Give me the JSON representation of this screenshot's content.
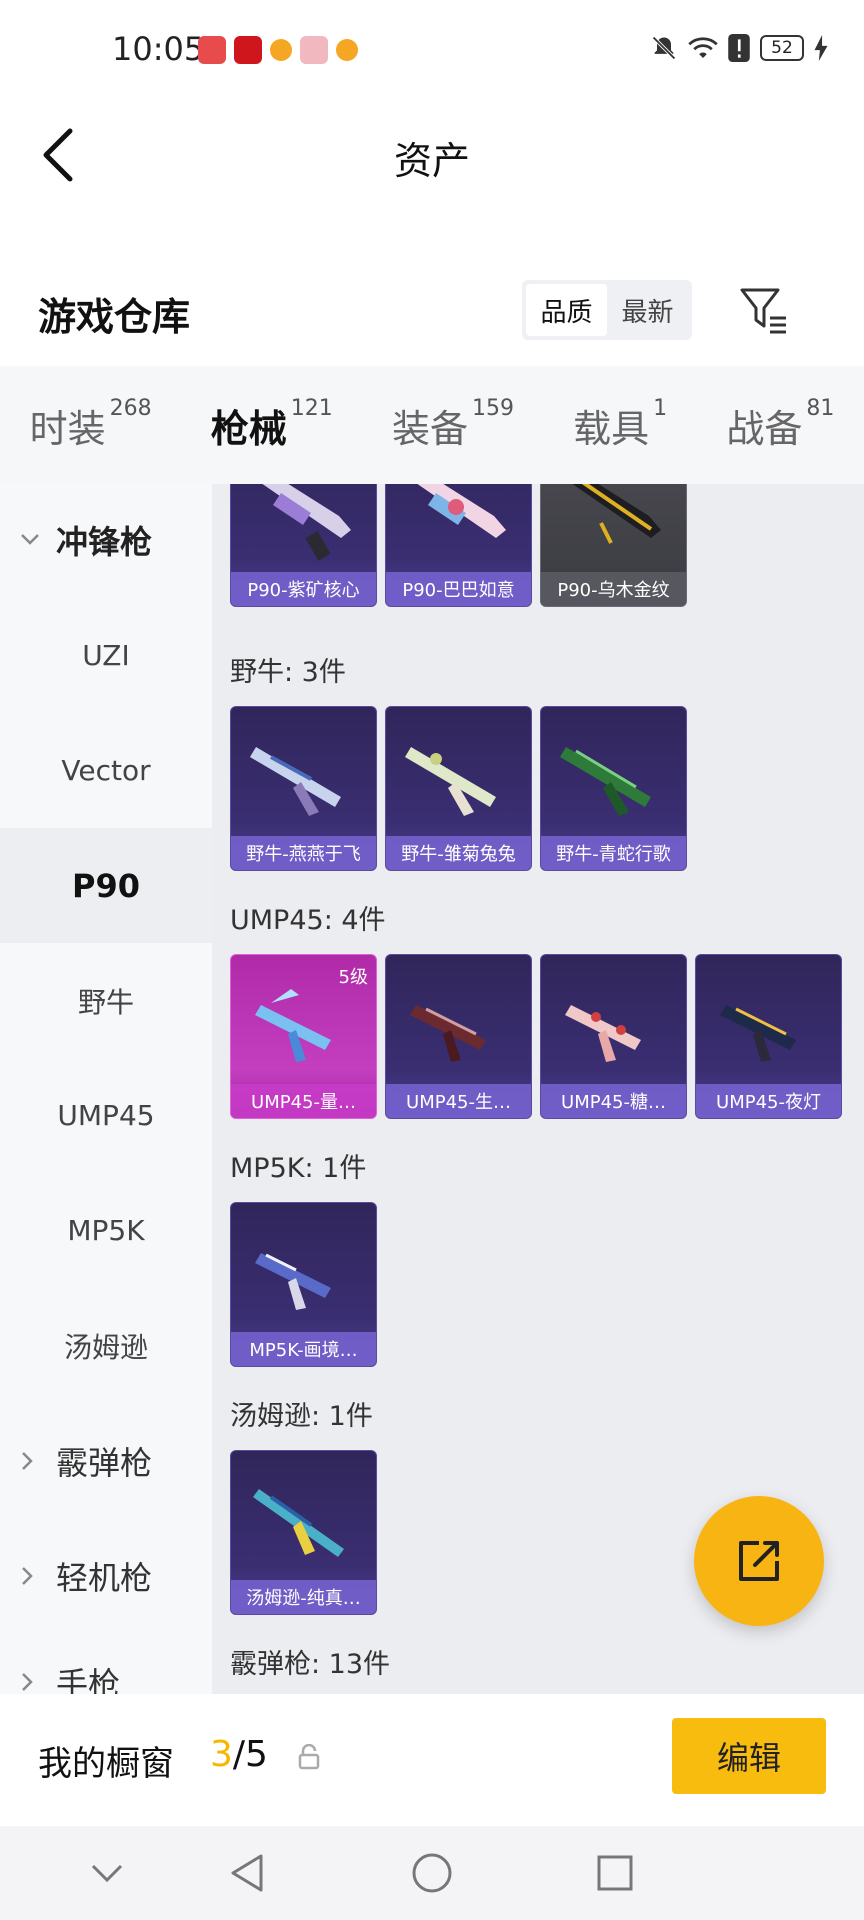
{
  "status_bar": {
    "time": "10:05",
    "battery": "52"
  },
  "header": {
    "title": "资产"
  },
  "warehouse": {
    "title": "游戏仓库",
    "sort_options": [
      "品质",
      "最新"
    ]
  },
  "tabs": [
    {
      "label": "时装",
      "count": "268"
    },
    {
      "label": "枪械",
      "count": "121"
    },
    {
      "label": "装备",
      "count": "159"
    },
    {
      "label": "载具",
      "count": "1"
    },
    {
      "label": "战备",
      "count": "81"
    }
  ],
  "side_nav": {
    "group_smg": "冲锋枪",
    "items": [
      "UZI",
      "Vector",
      "P90",
      "野牛",
      "UMP45",
      "MP5K",
      "汤姆逊"
    ],
    "group_shotgun": "霰弹枪",
    "group_lmg": "轻机枪",
    "group_pistol_partial": "手枪"
  },
  "content": {
    "p90_cards": [
      "P90-紫矿核心",
      "P90-巴巴如意",
      "P90-乌木金纹"
    ],
    "bison_title": "野牛: 3件",
    "bison_cards": [
      "野牛-燕燕于飞",
      "野牛-雏菊兔兔",
      "野牛-青蛇行歌"
    ],
    "ump_title": "UMP45: 4件",
    "ump_cards": [
      "UMP45-量…",
      "UMP45-生…",
      "UMP45-糖…",
      "UMP45-夜灯"
    ],
    "ump_badge": "5级",
    "mp5k_title": "MP5K: 1件",
    "mp5k_cards": [
      "MP5K-画境…"
    ],
    "thompson_title": "汤姆逊: 1件",
    "thompson_cards": [
      "汤姆逊-纯真…"
    ],
    "shotgun_title": "霰弹枪: 13件"
  },
  "bottom": {
    "showcase_label": "我的橱窗",
    "showcase_current": "3",
    "showcase_total": "/5",
    "edit_label": "编辑"
  },
  "colors": {
    "accent": "#f8bc0f",
    "card_purple": "#3a2e72",
    "card_pink": "#c33fc0"
  }
}
